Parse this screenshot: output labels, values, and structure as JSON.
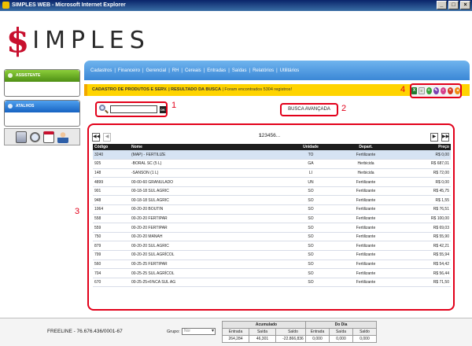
{
  "window": {
    "title": "SIMPLES WEB - Microsoft Internet Explorer",
    "buttons": [
      "_",
      "□",
      "×"
    ]
  },
  "logo": {
    "first": "$",
    "rest": "IMPLES"
  },
  "sidebar": {
    "assistente": "ASSISTENTE",
    "atalhos": "ATALHOS",
    "shortcut_icons": [
      "calculator-icon",
      "search-icon",
      "calendar-icon",
      "user-icon"
    ]
  },
  "menu": [
    "Cadastros",
    "Financeiro",
    "Gerencial",
    "RH",
    "Cereais",
    "Entradas",
    "Saídas",
    "Relatórios",
    "Utilitários"
  ],
  "header": {
    "title": "CADASTRO DE PRODUTOS E SERV. | RESULTADO DA BUSCA",
    "result": "Foram encontrados 5304 registros!"
  },
  "callouts": [
    "1",
    "2",
    "3",
    "4"
  ],
  "search": {
    "value": "",
    "ok": "OK"
  },
  "busca_avancada": "BUSCA AVANÇADA",
  "actions": [
    {
      "name": "excel-icon",
      "glyph": "X"
    },
    {
      "name": "document-icon",
      "glyph": "≡"
    },
    {
      "name": "add-icon",
      "glyph": "+"
    },
    {
      "name": "edit-icon",
      "glyph": "✎"
    },
    {
      "name": "print-icon",
      "glyph": "▪"
    },
    {
      "name": "delete-icon",
      "glyph": "×"
    },
    {
      "name": "back-icon",
      "glyph": "◂"
    }
  ],
  "pager": {
    "first": "◀◀",
    "prev": "◀",
    "pages": [
      "1",
      "2",
      "3",
      "4",
      "5",
      "6",
      "..."
    ],
    "current": "1",
    "next": "▶",
    "last": "▶▶"
  },
  "table": {
    "columns": [
      "Código",
      "Nome",
      "Unidade",
      "Depart.",
      "Preço"
    ],
    "rows": [
      [
        "3240",
        "(MAP) - FERTILIZE",
        "TO",
        "Fertilizante",
        "R$ 0,00"
      ],
      [
        "925",
        "-BORAL SC (5 L)",
        "GA",
        "Herbicida",
        "R$ 687,01"
      ],
      [
        "148",
        "-SANSON (1 L)",
        "LI",
        "Herbicida",
        "R$ 72,00"
      ],
      [
        "4899",
        "00-00-60 GRANULADO",
        "UN",
        "Fertilizante",
        "R$ 0,00"
      ],
      [
        "901",
        "00-18-18 SUL AGRIC",
        "SO",
        "Fertilizante",
        "R$ 45,75"
      ],
      [
        "948",
        "00-18-18 SUL AGRIC",
        "SO",
        "Fertilizante",
        "R$ 1,55"
      ],
      [
        "1064",
        "00-20-20 BOUTIN",
        "SO",
        "Fertilizante",
        "R$ 76,51"
      ],
      [
        "558",
        "00-20-20 FERTIPAR",
        "SO",
        "Fertilizante",
        "R$ 100,00"
      ],
      [
        "559",
        "00-20-20 FERTIPAR",
        "SO",
        "Fertilizante",
        "R$ 69,03"
      ],
      [
        "750",
        "00-20-20 MANAH",
        "SO",
        "Fertilizante",
        "R$ 55,90"
      ],
      [
        "879",
        "00-20-20 SUL AGRIC",
        "SO",
        "Fertilizante",
        "R$ 42,21"
      ],
      [
        "799",
        "00-20-20 SUL AGRÍCOL",
        "SO",
        "Fertilizante",
        "R$ 55,94"
      ],
      [
        "560",
        "00-25-25 FERTIPAR",
        "SO",
        "Fertilizante",
        "R$ 54,42"
      ],
      [
        "704",
        "00-25-25 SUL AGRÍCOL",
        "SO",
        "Fertilizante",
        "R$ 56,44"
      ],
      [
        "670",
        "00-25-25+6%CA SUL AG",
        "SO",
        "Fertilizante",
        "R$ 71,50"
      ]
    ]
  },
  "footer": {
    "company": "FREELINE - 76.676.436/0001-67",
    "grupo_label": "Grupo:",
    "grupo_value": "Nor",
    "acumulado": {
      "title": "Acumulado",
      "cols": [
        "Entrada",
        "Saída",
        "Saldo"
      ],
      "values": [
        "264,284",
        "46,301",
        "-22.866,836"
      ]
    },
    "do_dia": {
      "title": "Do Dia",
      "cols": [
        "Entrada",
        "Saída",
        "Saldo"
      ],
      "values": [
        "0,000",
        "0,000",
        "0,000"
      ]
    }
  }
}
